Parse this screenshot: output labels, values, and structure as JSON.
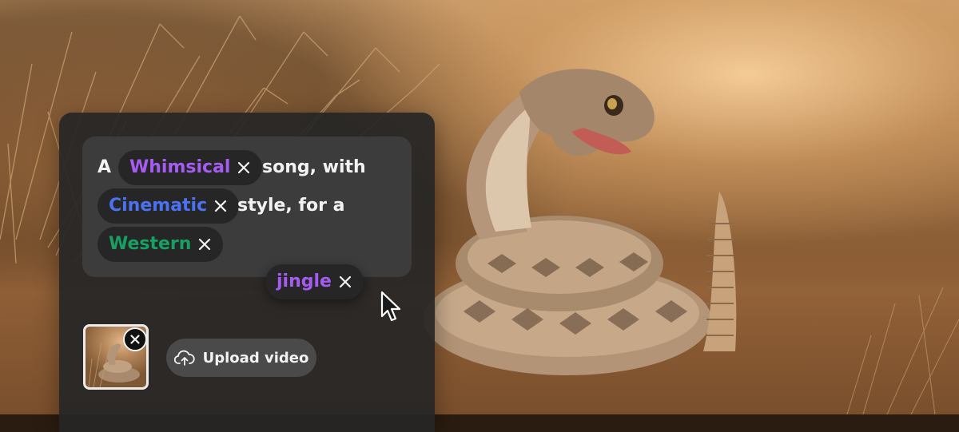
{
  "prompt": {
    "words": [
      "A",
      "song, with",
      "style, for a"
    ],
    "chips": [
      {
        "label": "Whimsical",
        "color": "#a55cf2"
      },
      {
        "label": "Cinematic",
        "color": "#4b72f2"
      },
      {
        "label": "Western",
        "color": "#17a062"
      },
      {
        "label": "jingle",
        "color": "#a55cf2"
      }
    ]
  },
  "upload": {
    "label": "Upload video",
    "icon": "cloud-upload-icon"
  },
  "thumbnail": {
    "remove_icon": "close-icon"
  },
  "icons": {
    "chip_remove": "close-icon",
    "pointer": "cursor-arrow-icon"
  }
}
